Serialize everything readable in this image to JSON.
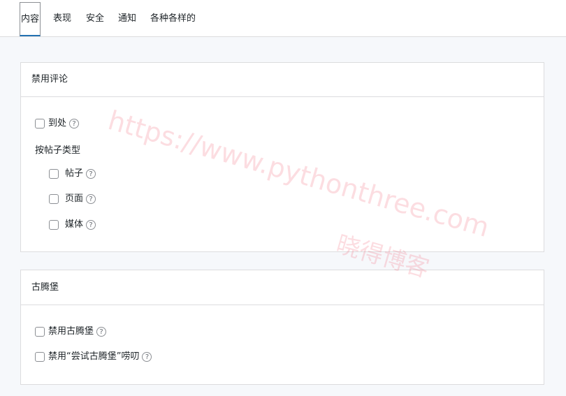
{
  "tabs": [
    {
      "label": "内容",
      "active": true
    },
    {
      "label": "表现",
      "active": false
    },
    {
      "label": "安全",
      "active": false
    },
    {
      "label": "通知",
      "active": false
    },
    {
      "label": "各种各样的",
      "active": false
    }
  ],
  "panels": {
    "disable_comments": {
      "title": "禁用评论",
      "everywhere_label": "到处",
      "by_post_type_title": "按帖子类型",
      "post_types": [
        {
          "label": "帖子"
        },
        {
          "label": "页面"
        },
        {
          "label": "媒体"
        }
      ]
    },
    "gutenberg": {
      "title": "古腾堡",
      "disable_gutenberg_label": "禁用古腾堡",
      "disable_try_gutenberg_label": "禁用“尝试古腾堡”唠叨"
    }
  },
  "help_glyph": "?",
  "icons": {
    "checkbox": "checkbox-icon",
    "help": "help-circle-icon"
  },
  "colors": {
    "active_tab_underline": "#2271b1",
    "border": "#dcdcde",
    "background": "#f6f8fb",
    "watermark": "#f06478"
  },
  "watermark": {
    "url": "https://www.pythonthree.com",
    "name": "晓得博客"
  }
}
